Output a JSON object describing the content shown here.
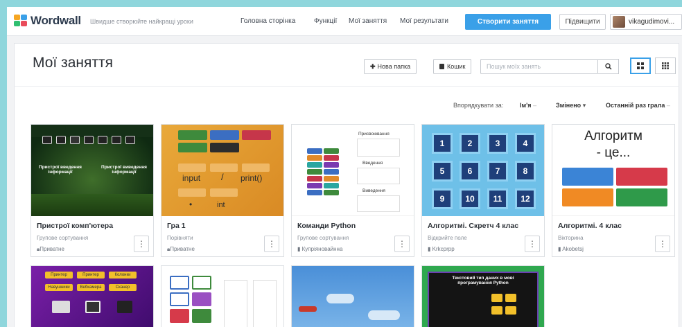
{
  "brand": {
    "name": "Wordwall",
    "tagline": "Швидше створюйте найкращі уроки"
  },
  "nav": {
    "links": [
      "Головна сторінка",
      "Функції",
      "Мої заняття",
      "Мої результати"
    ],
    "create": "Створити заняття",
    "upgrade": "Підвищити",
    "user": "vikagudimovi..."
  },
  "header": {
    "title": "Мої заняття",
    "new_folder": "Нова папка",
    "trash": "Кошик",
    "search_placeholder": "Пошук моїх занять"
  },
  "sort": {
    "label": "Впорядкувати за:",
    "name": "Ім'я",
    "modified": "Змінено",
    "last_played": "Останній раз грала"
  },
  "cards": [
    {
      "title": "Пристрої комп'ютера",
      "type": "Групове сортування",
      "owner": "Приватне",
      "thumb_text": [
        "Пристрої введення інформації",
        "Пристрої виведення інформації"
      ]
    },
    {
      "title": "Гра 1",
      "type": "Порівняти",
      "owner": "Приватне",
      "thumb_text": [
        "input",
        "/",
        "print()",
        "int"
      ]
    },
    {
      "title": "Команди Python",
      "type": "Групове сортування",
      "owner": "Купріяновайнна",
      "thumb_text": [
        "Присвоювання",
        "Введення",
        "Виведення"
      ]
    },
    {
      "title": "Алгоритмі. Скретч 4 клас",
      "type": "Відкрийте поле",
      "owner": "Krkcprpp",
      "thumb_text": [
        "1",
        "2",
        "3",
        "4",
        "5",
        "6",
        "7",
        "8",
        "9",
        "10",
        "11",
        "12"
      ]
    },
    {
      "title": "Алгоритмі. 4 клас",
      "type": "Вікторина",
      "owner": "Akobetsj",
      "thumb_text": [
        "Алгоритм",
        "- це..."
      ]
    },
    {
      "thumb_text": [
        "Принтер",
        "Принтер",
        "Колонки",
        "Навушники",
        "Вебкамера",
        "Сканер"
      ]
    },
    {
      "thumb_text": []
    },
    {
      "thumb_text": []
    },
    {
      "thumb_text": [
        "Текстовий тип даних в мові програмування Python"
      ]
    }
  ],
  "colors": {
    "accent": "#3aa0e8",
    "bg": "#8fd6dc"
  }
}
